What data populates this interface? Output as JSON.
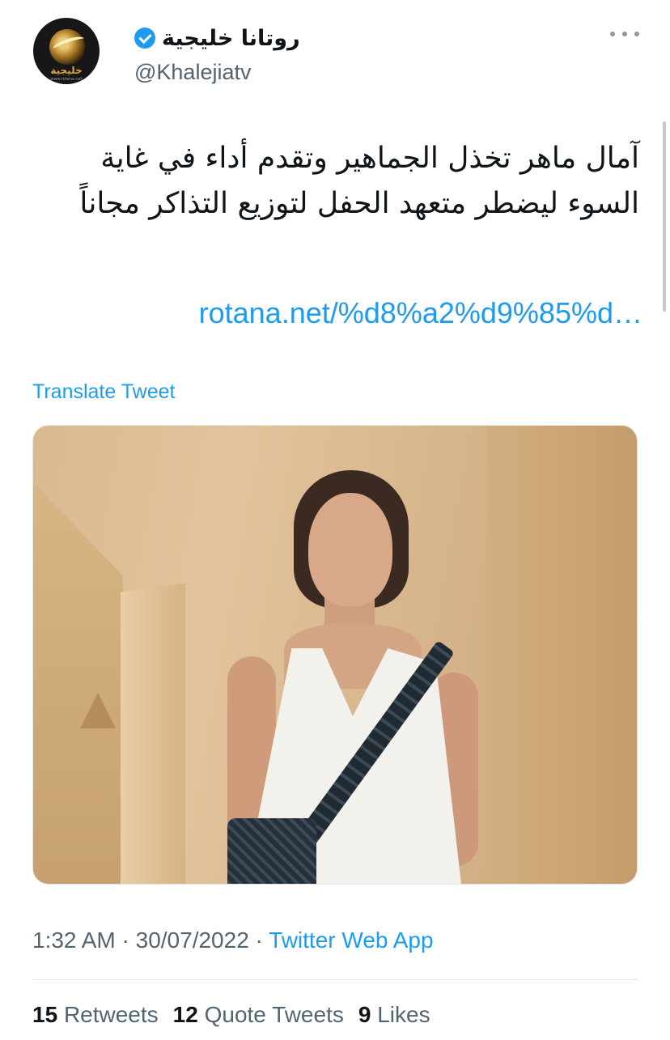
{
  "header": {
    "display_name": "روتانا خليجية",
    "handle": "@Khalejiatv",
    "avatar_logo_text": "خليجية",
    "avatar_logo_sub": "www.rotana.net",
    "verified_icon": "verified-badge-icon",
    "more_icon": "more-options-icon"
  },
  "tweet": {
    "text": "آمال ماهر تخذل الجماهير وتقدم أداء في غاية السوء ليضطر متعهد الحفل لتوزيع التذاكر مجاناً",
    "link": "rotana.net/%d8%a2%d9%85%d…",
    "translate_label": "Translate Tweet"
  },
  "meta": {
    "time": "1:32 AM",
    "separator": "·",
    "date": "30/07/2022",
    "app": "Twitter Web App"
  },
  "stats": {
    "retweets_count": "15",
    "retweets_label": "Retweets",
    "quote_count": "12",
    "quote_label": "Quote Tweets",
    "likes_count": "9",
    "likes_label": "Likes"
  },
  "colors": {
    "link": "#1d9bf0",
    "secondary_text": "#536471",
    "primary_text": "#0f1419"
  }
}
